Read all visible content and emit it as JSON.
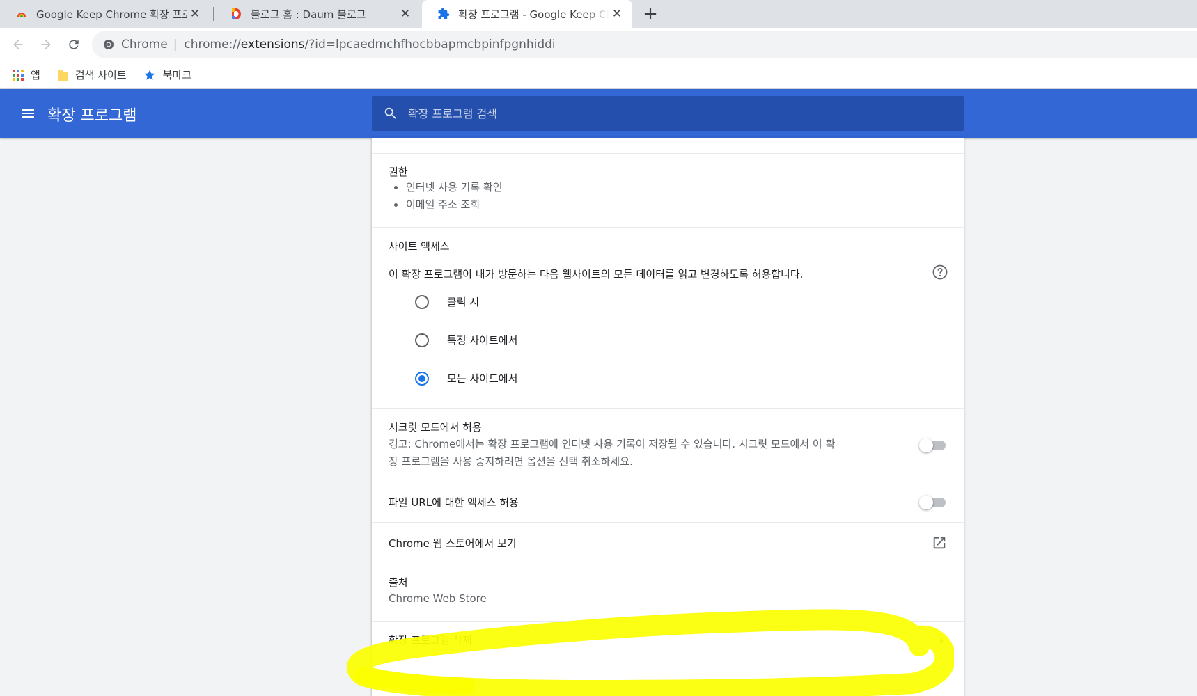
{
  "tabs": [
    {
      "title": "Google Keep Chrome 확장 프로그",
      "favicon": "google-keep-favicon"
    },
    {
      "title": "블로그 홈 : Daum 블로그",
      "favicon": "daum-favicon"
    },
    {
      "title": "확장 프로그램 - Google Keep Ch",
      "favicon": "puzzle-icon"
    }
  ],
  "toolbar": {
    "omnibox": {
      "chip": "Chrome",
      "separator": "|",
      "scheme": "chrome://",
      "host": "extensions",
      "path": "/?id=lpcaedmchfhocbbapmcbpinfpgnhiddi"
    }
  },
  "bookmarks": {
    "apps": "앱",
    "folder": "검색 사이트",
    "bookmark": "북마크"
  },
  "header": {
    "title": "확장 프로그램",
    "search_placeholder": "확장 프로그램 검색"
  },
  "permissions": {
    "title": "권한",
    "items": [
      "인터넷 사용 기록 확인",
      "이메일 주소 조회"
    ]
  },
  "site_access": {
    "title": "사이트 액세스",
    "description": "이 확장 프로그램이 내가 방문하는 다음 웹사이트의 모든 데이터를 읽고 변경하도록 허용합니다.",
    "options": [
      {
        "label": "클릭 시",
        "checked": false
      },
      {
        "label": "특정 사이트에서",
        "checked": false
      },
      {
        "label": "모든 사이트에서",
        "checked": true
      }
    ]
  },
  "incognito": {
    "title": "시크릿 모드에서 허용",
    "warning_line1": "경고: Chrome에서는 확장 프로그램에 인터넷 사용 기록이 저장될 수 있습니다. 시크릿 모드에서 이 확",
    "warning_line2": "장 프로그램을 사용 중지하려면 옵션을 선택 취소하세요.",
    "enabled": false
  },
  "file_urls": {
    "title": "파일 URL에 대한 액세스 허용",
    "enabled": false
  },
  "webstore_link": {
    "label": "Chrome 웹 스토어에서 보기"
  },
  "source": {
    "title": "출처",
    "value": "Chrome Web Store"
  },
  "remove": {
    "label": "확장 프로그램 삭제"
  },
  "colors": {
    "header_blue": "#3367d6",
    "search_blue": "#254fac",
    "radio_blue": "#1a73e8",
    "highlight_yellow": "#fbff00"
  }
}
